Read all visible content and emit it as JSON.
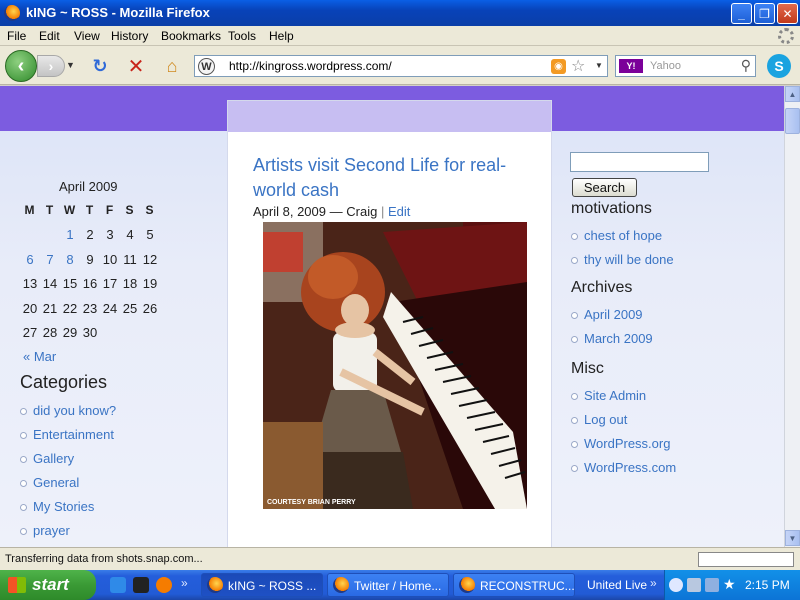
{
  "window": {
    "title": "kING ~ ROSS - Mozilla Firefox",
    "min": "_",
    "max": "❐",
    "close": "✕"
  },
  "menu": [
    "File",
    "Edit",
    "View",
    "History",
    "Bookmarks",
    "Tools",
    "Help"
  ],
  "toolbar": {
    "url": "http://kingross.wordpress.com/",
    "search_placeholder": "Yahoo",
    "search_engine": "Y!"
  },
  "page": {
    "post": {
      "title": "Artists visit Second Life for real-world cash",
      "date": "April 8, 2009",
      "dash": "—",
      "author": "Craig",
      "sep": "|",
      "edit": "Edit",
      "photo_credit": "COURTESY BRIAN PERRY"
    },
    "calendar": {
      "caption": "April 2009",
      "weekdays": [
        "M",
        "T",
        "W",
        "T",
        "F",
        "S",
        "S"
      ],
      "weeks": [
        [
          "",
          "",
          "1",
          "2",
          "3",
          "4",
          "5"
        ],
        [
          "6",
          "7",
          "8",
          "9",
          "10",
          "11",
          "12"
        ],
        [
          "13",
          "14",
          "15",
          "16",
          "17",
          "18",
          "19"
        ],
        [
          "20",
          "21",
          "22",
          "23",
          "24",
          "25",
          "26"
        ],
        [
          "27",
          "28",
          "29",
          "30",
          "",
          "",
          ""
        ]
      ],
      "linked_days": [
        "1",
        "6",
        "7",
        "8"
      ],
      "prev": "« Mar"
    },
    "categories": {
      "heading": "Categories",
      "items": [
        "did you know?",
        "Entertainment",
        "Gallery",
        "General",
        "My Stories",
        "prayer"
      ]
    },
    "sidebar_right": {
      "search_button": "Search",
      "motivations": {
        "heading": "motivations",
        "items": [
          "chest of hope",
          "thy will be done"
        ]
      },
      "archives": {
        "heading": "Archives",
        "items": [
          "April 2009",
          "March 2009"
        ]
      },
      "misc": {
        "heading": "Misc",
        "items": [
          "Site Admin",
          "Log out",
          "WordPress.org",
          "WordPress.com"
        ]
      }
    }
  },
  "status": "Transferring data from shots.snap.com...",
  "taskbar": {
    "start": "start",
    "tasks": [
      "kING ~ ROSS ...",
      "Twitter / Home...",
      "RECONSTRUC..."
    ],
    "united": "United Live",
    "clock": "2:15 PM"
  },
  "colors": {
    "link": "#3a74c4",
    "banner": "#7c5ce0",
    "taskbar": "#245edb"
  }
}
